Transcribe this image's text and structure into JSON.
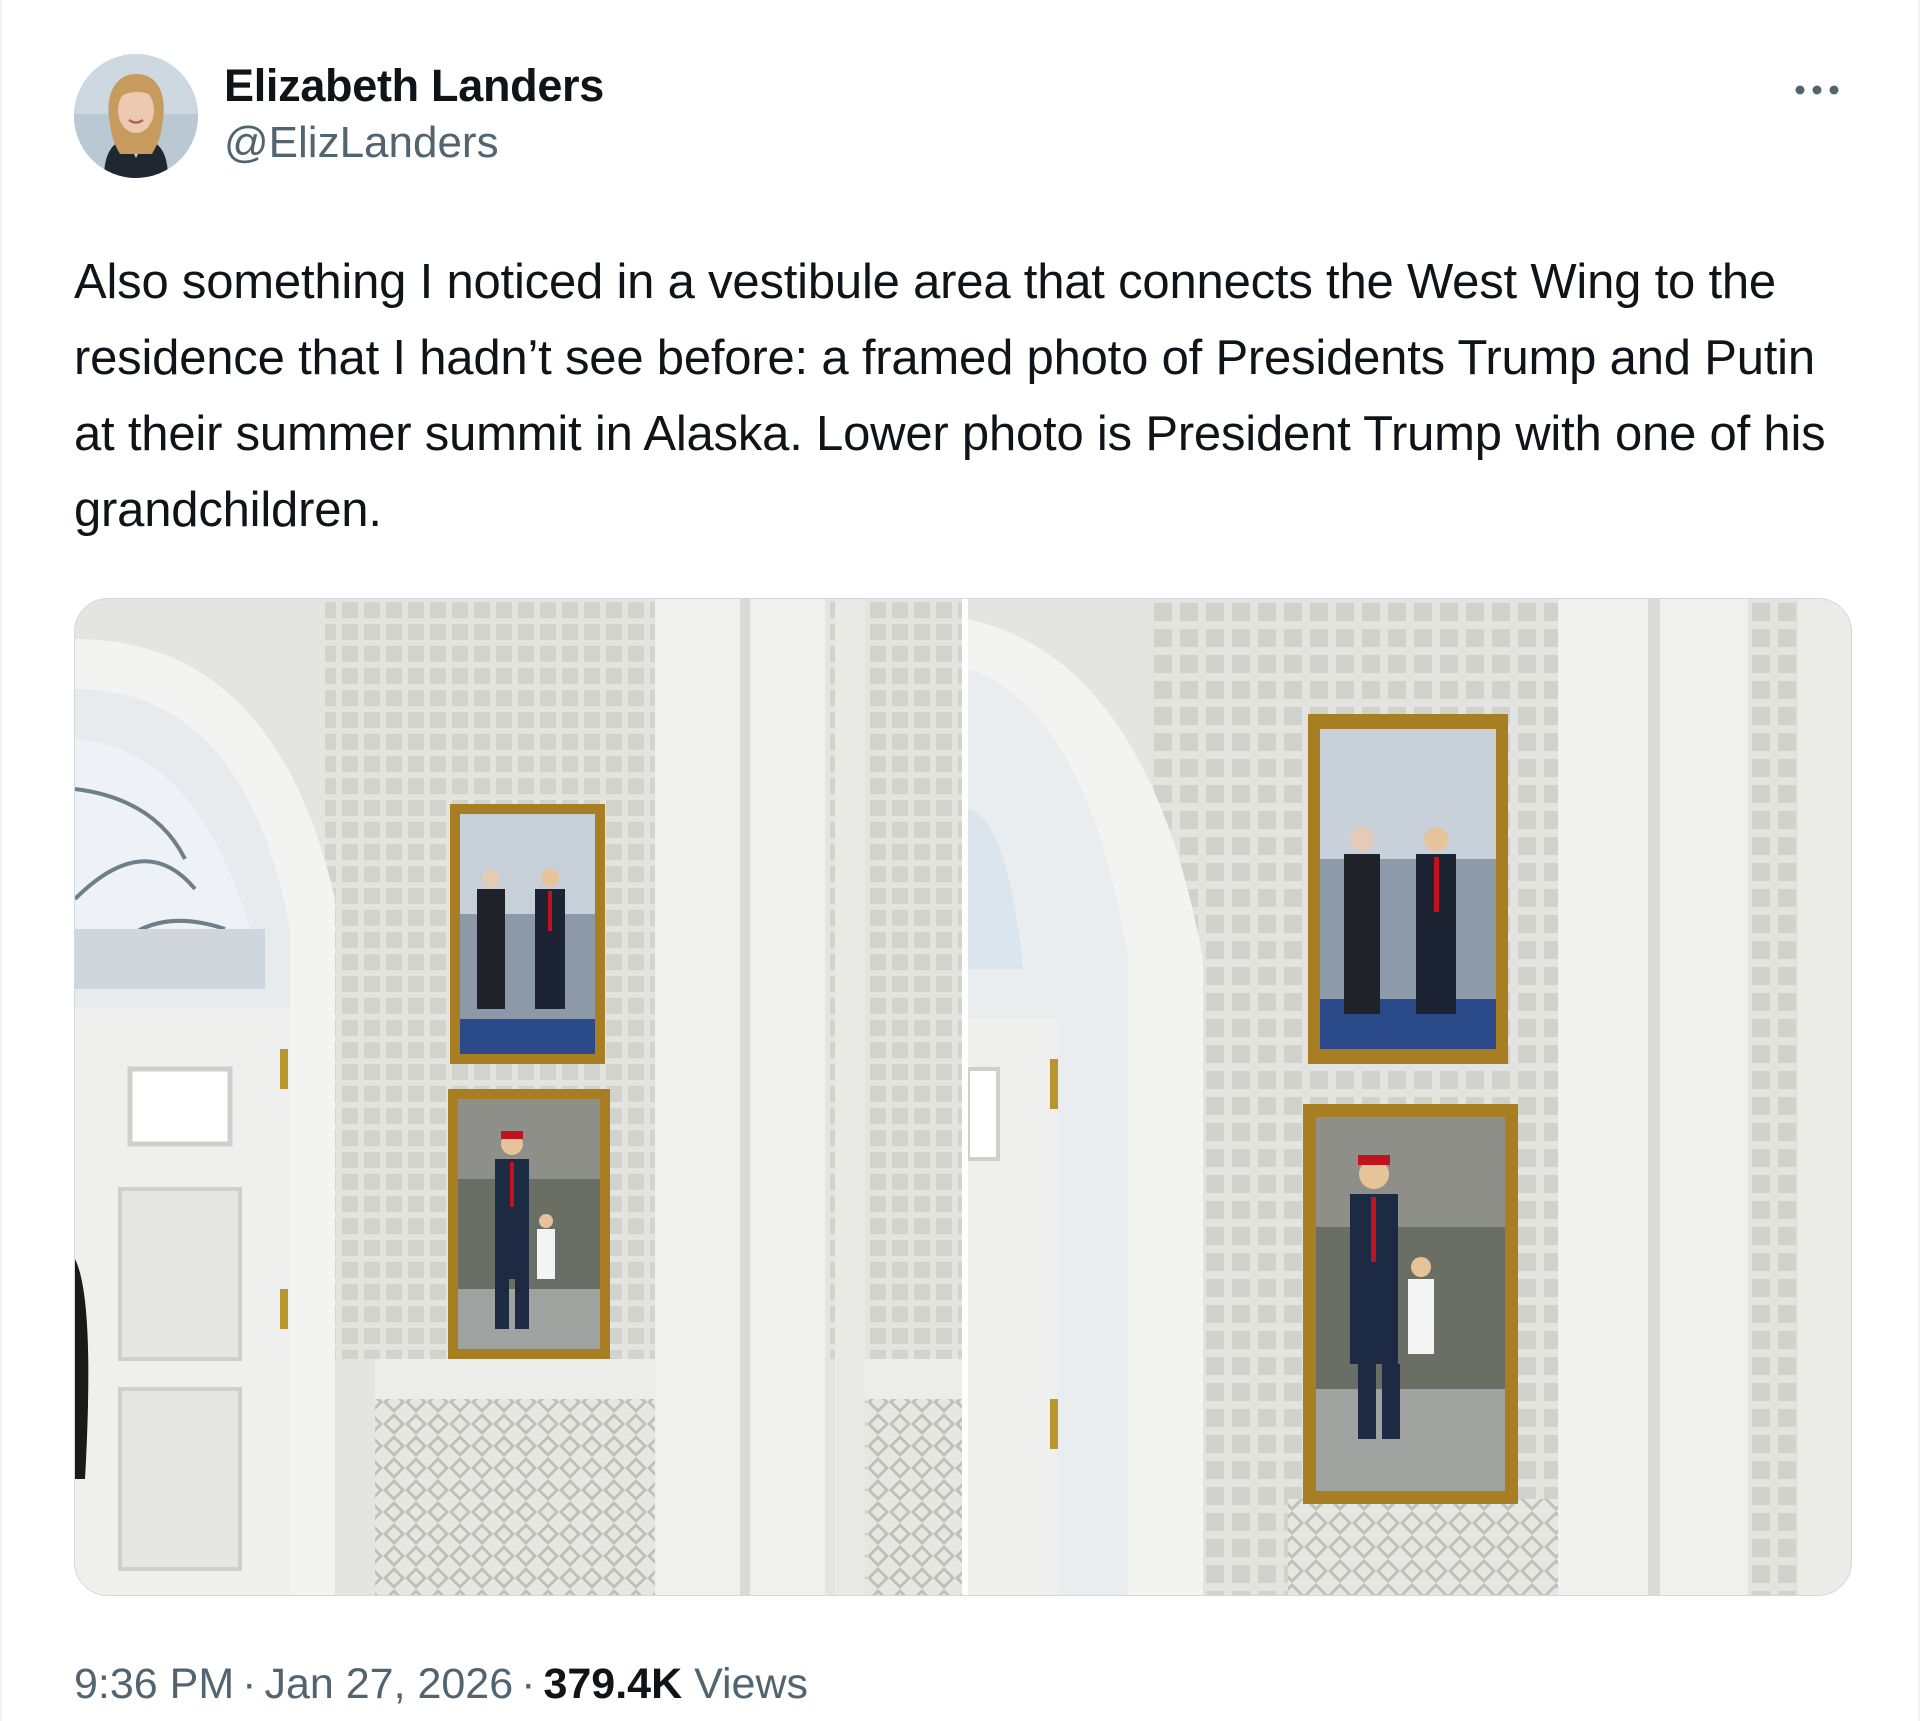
{
  "author": {
    "display_name": "Elizabeth Landers",
    "handle": "@ElizLanders",
    "avatar_icon": "profile-photo"
  },
  "tweet": {
    "text": "Also something I noticed in a vestibule area that connects the West Wing to the residence that I hadn’t see before: a framed photo of Presidents Trump and Putin at their summer summit in Alaska. Lower photo is President Trump with one of his grandchildren.",
    "time": "9:36 PM",
    "date": "Jan 27, 2026",
    "separator": "·",
    "views_count": "379.4K",
    "views_label": "Views"
  },
  "menu": {
    "more_icon": "ellipsis-icon"
  },
  "media": {
    "photo_count": 2,
    "frame_color": "#a87e22",
    "wall_color": "#e6e6e3"
  }
}
